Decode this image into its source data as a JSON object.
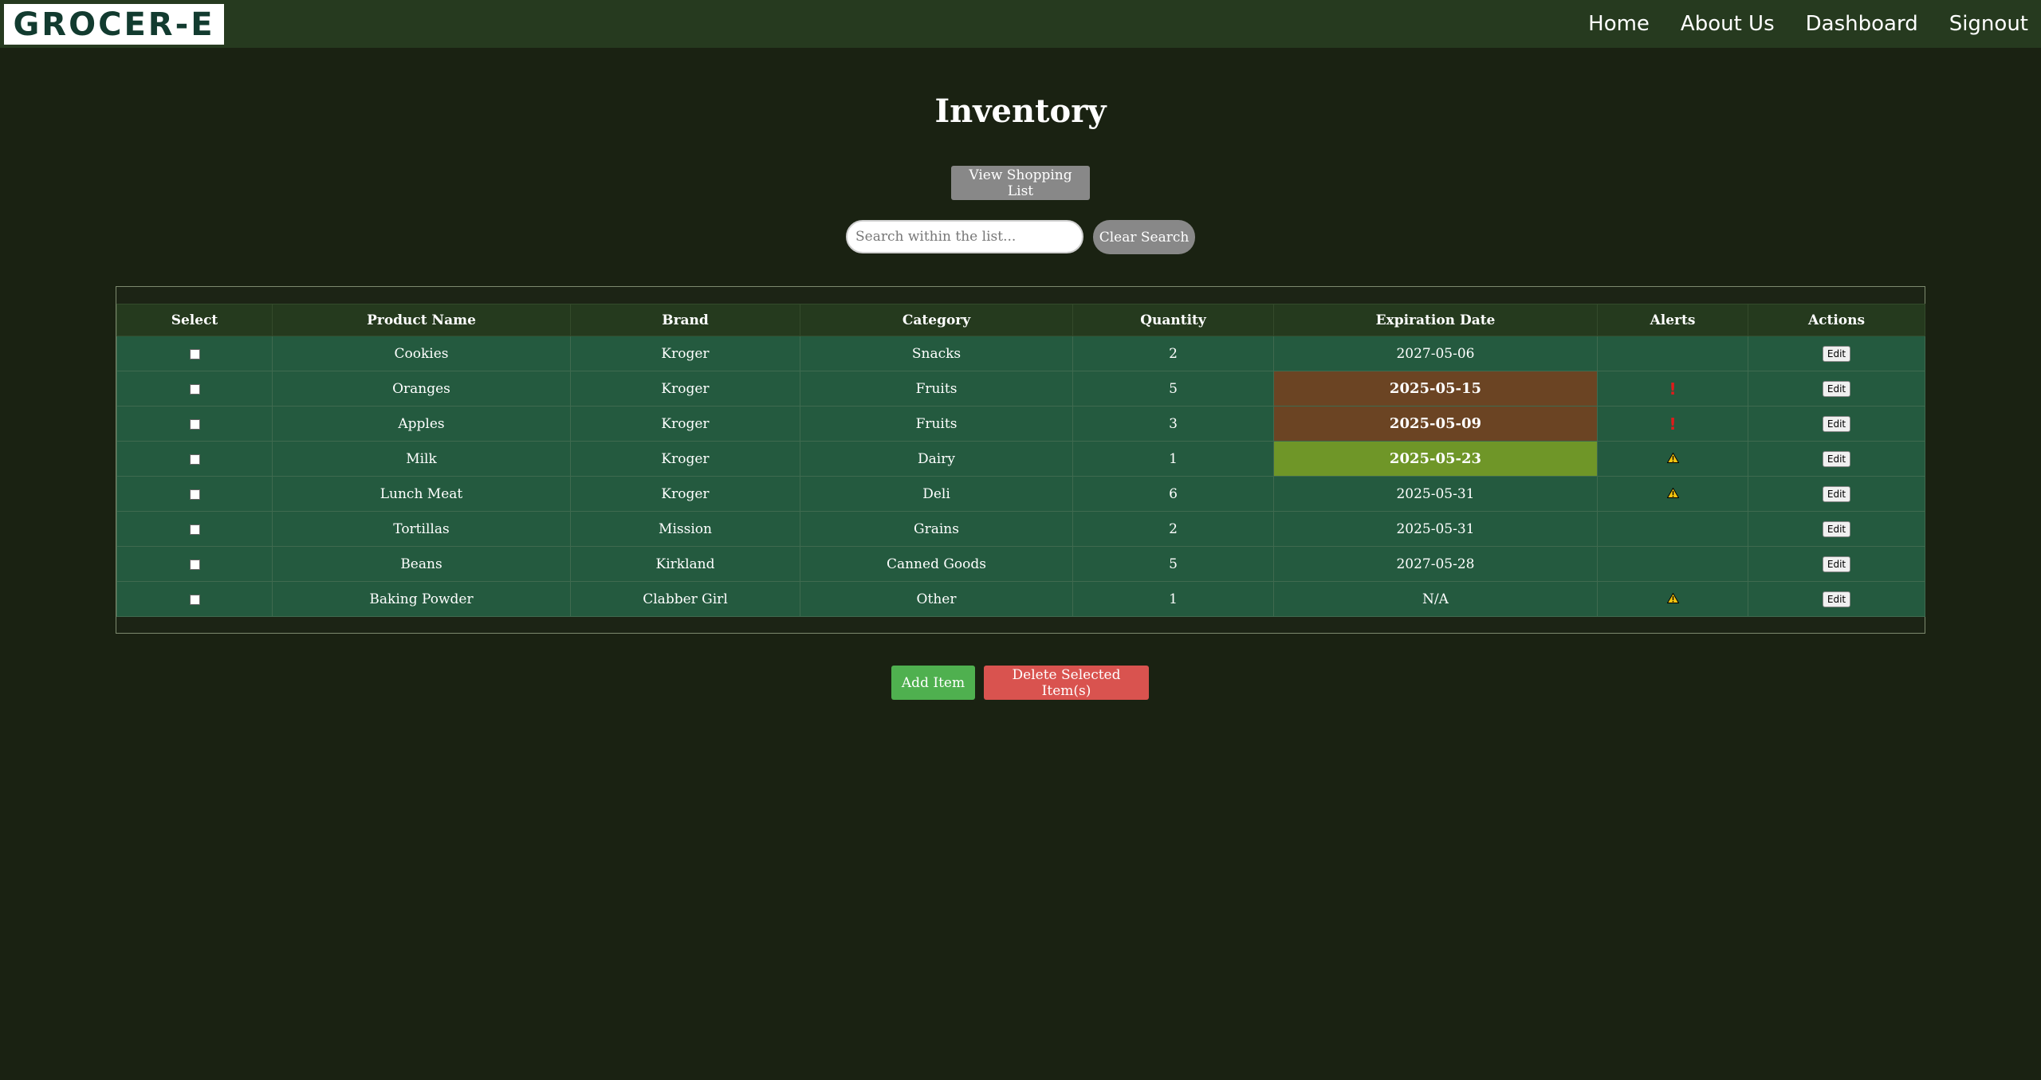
{
  "nav": {
    "logo_text": "GROCER-E",
    "links": [
      "Home",
      "About Us",
      "Dashboard",
      "Signout"
    ]
  },
  "page": {
    "title": "Inventory",
    "view_list_label": "View Shopping List",
    "search_placeholder": "Search within the list...",
    "search_value": "",
    "clear_label": "Clear Search"
  },
  "table": {
    "headers": [
      "Select",
      "Product Name",
      "Brand",
      "Category",
      "Quantity",
      "Expiration Date",
      "Alerts",
      "Actions"
    ],
    "edit_label": "Edit",
    "rows": [
      {
        "name": "Cookies",
        "brand": "Kroger",
        "category": "Snacks",
        "quantity": "2",
        "expiration": "2027-05-06",
        "exp_status": "normal",
        "alert": "none",
        "checked": false
      },
      {
        "name": "Oranges",
        "brand": "Kroger",
        "category": "Fruits",
        "quantity": "5",
        "expiration": "2025-05-15",
        "exp_status": "expired",
        "alert": "exclamation-icon",
        "checked": false
      },
      {
        "name": "Apples",
        "brand": "Kroger",
        "category": "Fruits",
        "quantity": "3",
        "expiration": "2025-05-09",
        "exp_status": "expired",
        "alert": "exclamation-icon",
        "checked": false
      },
      {
        "name": "Milk",
        "brand": "Kroger",
        "category": "Dairy",
        "quantity": "1",
        "expiration": "2025-05-23",
        "exp_status": "expiring-soon",
        "alert": "warning-icon",
        "checked": false
      },
      {
        "name": "Lunch Meat",
        "brand": "Kroger",
        "category": "Deli",
        "quantity": "6",
        "expiration": "2025-05-31",
        "exp_status": "normal",
        "alert": "warning-icon",
        "checked": false
      },
      {
        "name": "Tortillas",
        "brand": "Mission",
        "category": "Grains",
        "quantity": "2",
        "expiration": "2025-05-31",
        "exp_status": "normal",
        "alert": "none",
        "checked": false
      },
      {
        "name": "Beans",
        "brand": "Kirkland",
        "category": "Canned Goods",
        "quantity": "5",
        "expiration": "2027-05-28",
        "exp_status": "normal",
        "alert": "none",
        "checked": false
      },
      {
        "name": "Baking Powder",
        "brand": "Clabber Girl",
        "category": "Other",
        "quantity": "1",
        "expiration": "N/A",
        "exp_status": "normal",
        "alert": "warning-icon",
        "checked": false
      }
    ]
  },
  "actions": {
    "add_label": "Add Item",
    "delete_label": "Delete Selected Item(s)"
  },
  "colors": {
    "background": "#1a2212",
    "navbar": "#263a1f",
    "row": "#245a3f",
    "expired": "#6b4423",
    "expiring_soon": "#6f9628",
    "add_button": "#4fb04f",
    "delete_button": "#d9534f"
  }
}
